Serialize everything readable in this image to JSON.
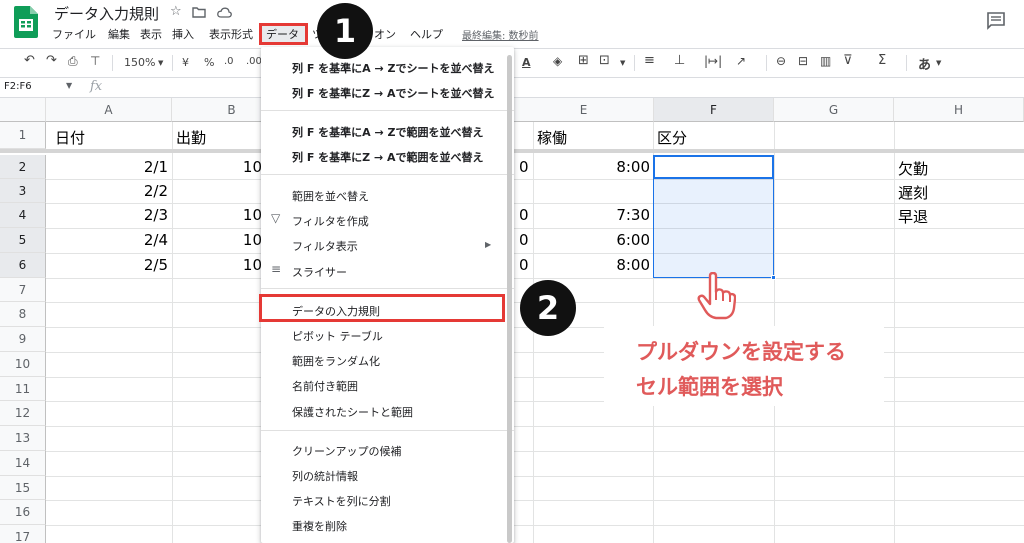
{
  "doc": {
    "title": "データ入力規則",
    "last_edit": "最終編集: 数秒前"
  },
  "menubar": {
    "items": [
      "ファイル",
      "編集",
      "表示",
      "挿入",
      "表示形式",
      "データ",
      "ツ",
      "オン",
      "ヘルプ"
    ],
    "active": "データ"
  },
  "toolbar": {
    "zoom": "150%",
    "currency": "¥",
    "percent": "%",
    "dec_decrease": ".0",
    "dec_increase": ".00",
    "text_color": "A",
    "input_method": "あ"
  },
  "formula_bar": {
    "name_box": "F2:F6",
    "fx": "fx"
  },
  "grid": {
    "columns": [
      "A",
      "B",
      "E",
      "F",
      "G",
      "H"
    ],
    "selected_column": "F",
    "rows": [
      "1",
      "2",
      "3",
      "4",
      "5",
      "6",
      "7",
      "8",
      "9",
      "10",
      "11",
      "12",
      "13",
      "14",
      "15",
      "16",
      "17"
    ],
    "selected_rows": [
      "2",
      "3",
      "4",
      "5",
      "6"
    ],
    "header_row": {
      "A": "日付",
      "B": "出勤",
      "D_partial": "",
      "E": "稼働",
      "F": "区分"
    },
    "data_rows": [
      {
        "A": "2/1",
        "B": "10",
        "D_partial": "0",
        "E": "8:00",
        "H": "欠勤"
      },
      {
        "A": "2/2",
        "B": "",
        "D_partial": "",
        "E": "",
        "H": "遅刻"
      },
      {
        "A": "2/3",
        "B": "10",
        "D_partial": "0",
        "E": "7:30",
        "H": "早退"
      },
      {
        "A": "2/4",
        "B": "10",
        "D_partial": "0",
        "E": "6:00",
        "H": ""
      },
      {
        "A": "2/5",
        "B": "10",
        "D_partial": "0",
        "E": "8:00",
        "H": ""
      }
    ]
  },
  "data_menu": {
    "groups": [
      [
        "列 F を基準にA → Zでシートを並べ替え",
        "列 F を基準にZ → Aでシートを並べ替え"
      ],
      [
        "列 F を基準にA → Zで範囲を並べ替え",
        "列 F を基準にZ → Aで範囲を並べ替え"
      ],
      [
        "範囲を並べ替え",
        "フィルタを作成",
        "フィルタ表示",
        "スライサー"
      ],
      [
        "データの入力規則",
        "ピボット テーブル",
        "範囲をランダム化",
        "名前付き範囲",
        "保護されたシートと範囲"
      ],
      [
        "クリーンアップの候補",
        "列の統計情報",
        "テキストを列に分割",
        "重複を削除"
      ]
    ]
  },
  "annotations": {
    "badge1": "1",
    "badge2": "2",
    "callout_line1": "プルダウンを設定する",
    "callout_line2": "セル範囲を選択",
    "highlight_color": "#e53935",
    "callout_color": "#e05a5a"
  },
  "colors": {
    "selection": "#1a73e8",
    "sheets_green": "#0f9d58"
  }
}
